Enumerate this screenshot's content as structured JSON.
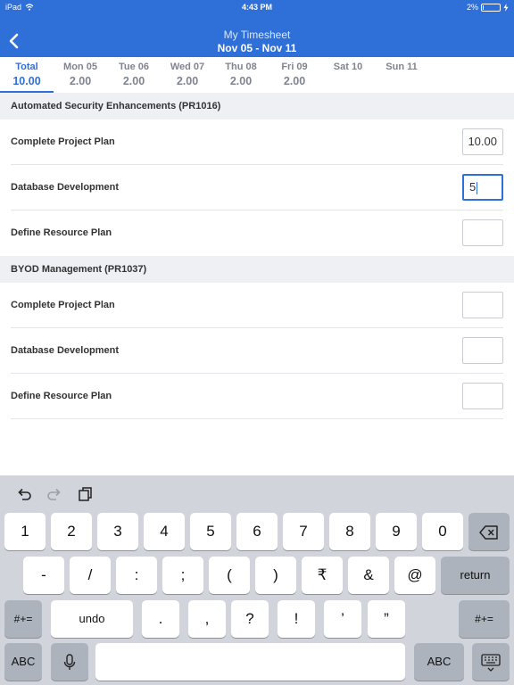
{
  "status_bar": {
    "device": "iPad",
    "time": "4:43 PM",
    "battery": "2%",
    "battery_level": 0.02
  },
  "header": {
    "title": "My Timesheet",
    "subtitle": "Nov 05 - Nov 11",
    "back_icon": "chevron-left-icon"
  },
  "tabs": [
    {
      "day": "Total",
      "value": "10.00",
      "active": true
    },
    {
      "day": "Mon 05",
      "value": "2.00"
    },
    {
      "day": "Tue 06",
      "value": "2.00"
    },
    {
      "day": "Wed 07",
      "value": "2.00"
    },
    {
      "day": "Thu 08",
      "value": "2.00"
    },
    {
      "day": "Fri 09",
      "value": "2.00"
    },
    {
      "day": "Sat 10",
      "value": ""
    },
    {
      "day": "Sun 11",
      "value": ""
    }
  ],
  "projects": [
    {
      "name": "Automated Security Enhancements (PR1016)",
      "tasks": [
        {
          "name": "Complete Project Plan",
          "value": "10.00"
        },
        {
          "name": "Database Development",
          "value": "5"
        },
        {
          "name": "Define Resource Plan",
          "value": ""
        }
      ]
    },
    {
      "name": "BYOD Management (PR1037)",
      "tasks": [
        {
          "name": "Complete Project Plan",
          "value": ""
        },
        {
          "name": "Database Development",
          "value": ""
        },
        {
          "name": "Define Resource Plan",
          "value": ""
        }
      ]
    }
  ],
  "keyboard": {
    "toolbar_icons": [
      "undo-icon",
      "redo-icon",
      "paste-icon"
    ],
    "row1": [
      "1",
      "2",
      "3",
      "4",
      "5",
      "6",
      "7",
      "8",
      "9",
      "0"
    ],
    "row2": [
      "-",
      "/",
      ":",
      ";",
      "(",
      ")",
      "₹",
      "&",
      "@"
    ],
    "return_label": "return",
    "row3_left": "#+=",
    "undo_label": "undo",
    "row3": [
      ".",
      ",",
      "?",
      "!",
      "’",
      "”"
    ],
    "row3_right": "#+=",
    "abc_label": "ABC",
    "abc_right_label": "ABC",
    "backspace_icon": "backspace-icon",
    "mic_icon": "microphone-icon",
    "dismiss_icon": "keyboard-dismiss-icon"
  },
  "colors": {
    "primary": "#2f6fd8",
    "section_bg": "#eef0f4",
    "keyboard_bg": "#d1d4da"
  }
}
